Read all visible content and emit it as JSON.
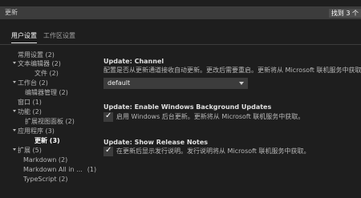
{
  "search": {
    "text": "更新",
    "results_badge": "找到 3 个"
  },
  "tabs": [
    {
      "label": "用户设置",
      "active": true
    },
    {
      "label": "工作区设置",
      "active": false
    }
  ],
  "tree": [
    {
      "label": "常用设置 (2)"
    },
    {
      "label": "文本编辑器 (2)"
    },
    {
      "label": "文件 (2)"
    },
    {
      "label": "工作台 (2)"
    },
    {
      "label": "编辑器管理 (2)"
    },
    {
      "label": "窗口 (1)"
    },
    {
      "label": "功能 (2)"
    },
    {
      "label": "扩展视图面板 (2)"
    },
    {
      "label": "应用程序 (3)"
    },
    {
      "label": "更新 (3)"
    },
    {
      "label": "扩展 (5)"
    },
    {
      "label": "Markdown (2)"
    },
    {
      "label": "Markdown All in ...",
      "count": "(1)"
    },
    {
      "label": "TypeScript (2)"
    }
  ],
  "settings": {
    "channel": {
      "title": "Update: Channel",
      "description": "配置是否从更新通道接收自动更新。更改后需要重启。更新将从 Microsoft 联机服务中获取。",
      "value": "default"
    },
    "windows_background": {
      "title": "Update: Enable Windows Background Updates",
      "label": "启用 Windows 后台更新。更新将从 Microsoft 联机服务中获取。",
      "checked": true
    },
    "release_notes": {
      "title": "Update: Show Release Notes",
      "label": "在更新后显示发行说明。发行说明将从 Microsoft 联机服务中获取。",
      "checked": true
    }
  },
  "colors": {
    "background": "#1e1e1e",
    "input": "#3c3c3c",
    "text": "#cccccc"
  }
}
